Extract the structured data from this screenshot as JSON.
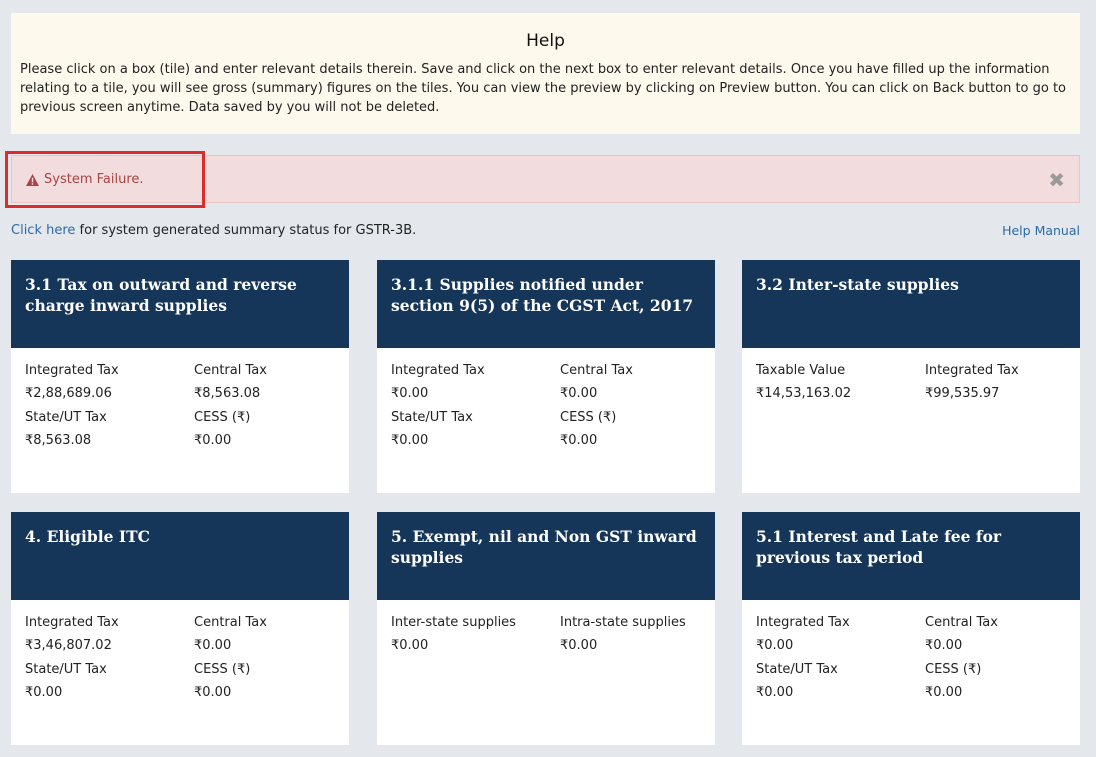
{
  "help": {
    "title": "Help",
    "text": "Please click on a box (tile) and enter relevant details therein. Save and click on the next box to enter relevant details. Once you have filled up the information relating to a tile, you will see gross (summary) figures on the tiles. You can view the preview by clicking on Preview button. You can click on Back button to go to previous screen anytime. Data saved by you will not be deleted."
  },
  "alert": {
    "message": "System Failure.",
    "close_symbol": "✖",
    "icon": "warning-triangle-icon"
  },
  "summary_link": {
    "link_text": "Click here",
    "rest_text": " for system generated summary status for GSTR-3B."
  },
  "help_manual": "Help Manual",
  "tiles": [
    {
      "title": "3.1 Tax on outward and reverse charge inward supplies",
      "fields": [
        {
          "label": "Integrated Tax",
          "value": "₹2,88,689.06"
        },
        {
          "label": "Central Tax",
          "value": "₹8,563.08"
        },
        {
          "label": "State/UT Tax",
          "value": "₹8,563.08"
        },
        {
          "label": "CESS (₹)",
          "value": "₹0.00"
        }
      ]
    },
    {
      "title": "3.1.1 Supplies notified under section 9(5) of the CGST Act, 2017",
      "fields": [
        {
          "label": "Integrated Tax",
          "value": "₹0.00"
        },
        {
          "label": "Central Tax",
          "value": "₹0.00"
        },
        {
          "label": "State/UT Tax",
          "value": "₹0.00"
        },
        {
          "label": "CESS (₹)",
          "value": "₹0.00"
        }
      ]
    },
    {
      "title": "3.2 Inter-state supplies",
      "fields": [
        {
          "label": "Taxable Value",
          "value": "₹14,53,163.02"
        },
        {
          "label": "Integrated Tax",
          "value": "₹99,535.97"
        }
      ]
    },
    {
      "title": "4. Eligible ITC",
      "fields": [
        {
          "label": "Integrated Tax",
          "value": "₹3,46,807.02"
        },
        {
          "label": "Central Tax",
          "value": "₹0.00"
        },
        {
          "label": "State/UT Tax",
          "value": "₹0.00"
        },
        {
          "label": "CESS (₹)",
          "value": "₹0.00"
        }
      ]
    },
    {
      "title": "5. Exempt, nil and Non GST inward supplies",
      "fields": [
        {
          "label": "Inter-state supplies",
          "value": "₹0.00"
        },
        {
          "label": "Intra-state supplies",
          "value": "₹0.00"
        }
      ]
    },
    {
      "title": "5.1 Interest and Late fee for previous tax period",
      "fields": [
        {
          "label": "Integrated Tax",
          "value": "₹0.00"
        },
        {
          "label": "Central Tax",
          "value": "₹0.00"
        },
        {
          "label": "State/UT Tax",
          "value": "₹0.00"
        },
        {
          "label": "CESS (₹)",
          "value": "₹0.00"
        }
      ]
    }
  ],
  "colors": {
    "tile_header": "#163659",
    "link": "#2c6aa8",
    "alert_bg": "#f2dcdd",
    "alert_text": "#a94442",
    "help_bg": "#fdf9ec"
  }
}
